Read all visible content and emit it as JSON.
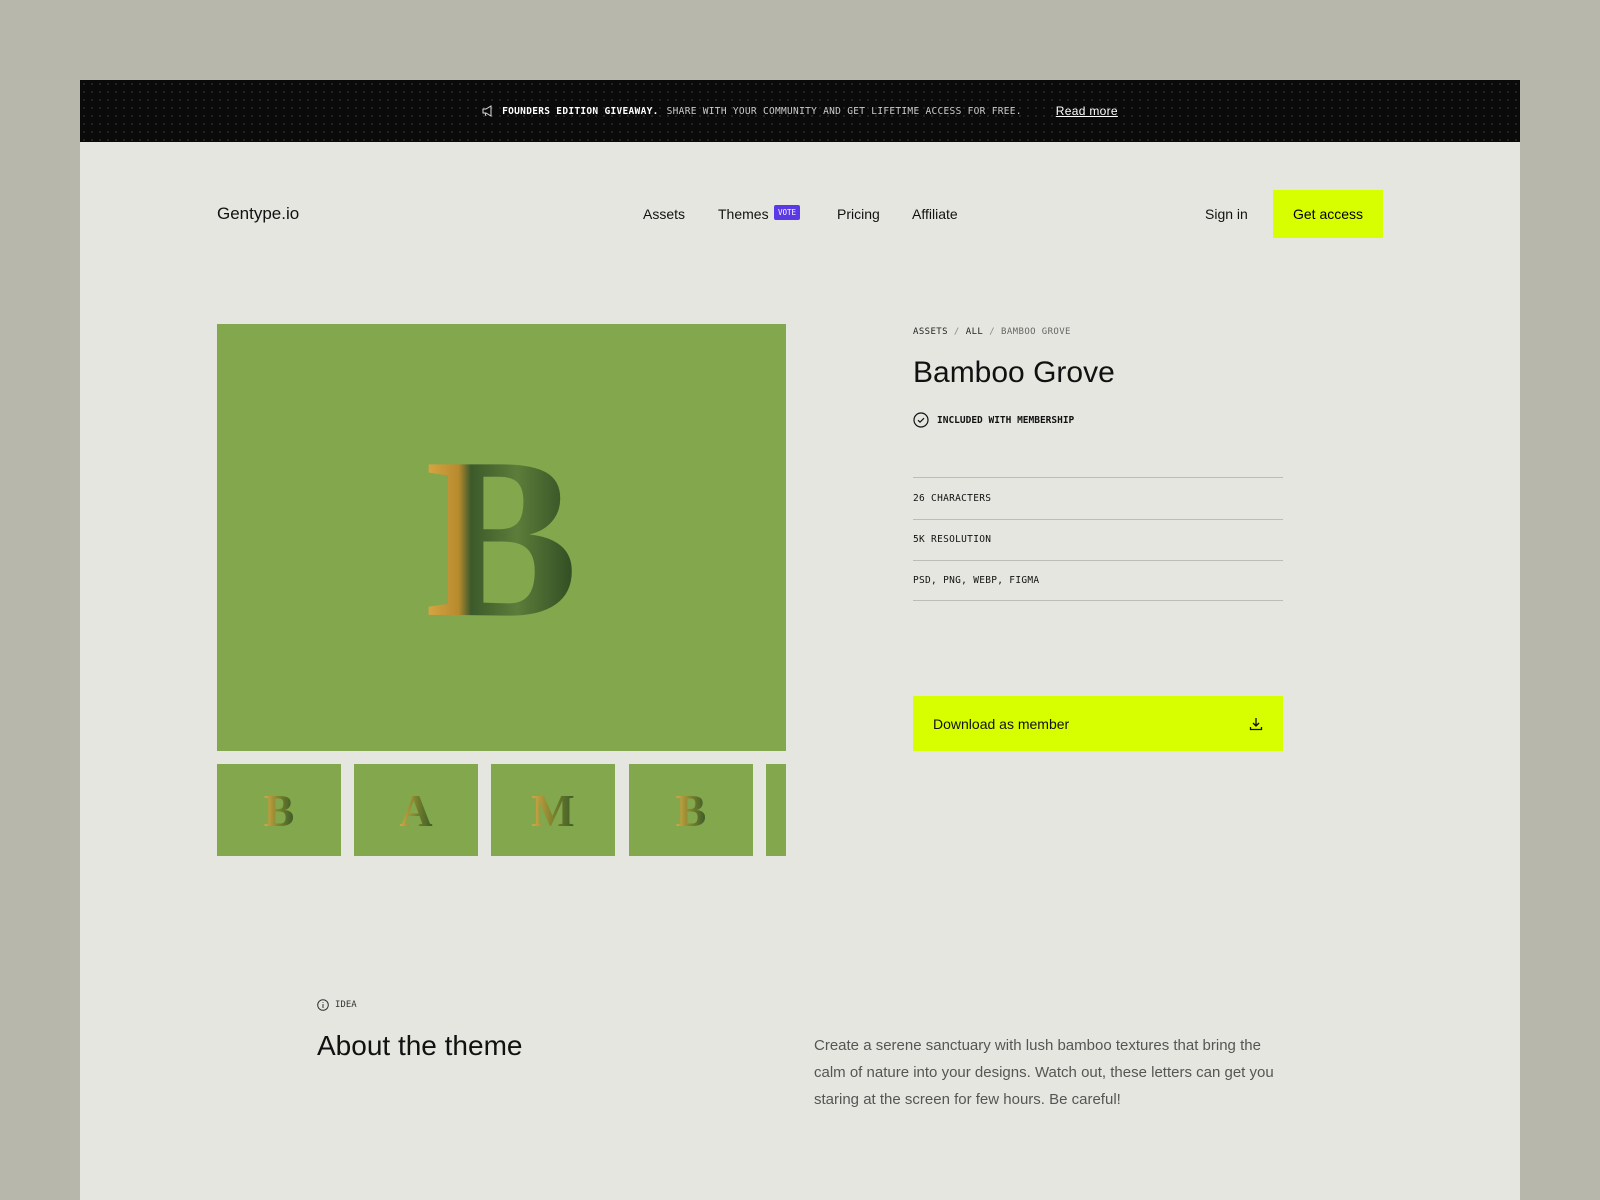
{
  "banner": {
    "icon": "megaphone-icon",
    "headline": "FOUNDERS EDITION GIVEAWAY.",
    "text": "SHARE WITH YOUR COMMUNITY AND GET LIFETIME ACCESS FOR FREE.",
    "link": "Read more"
  },
  "nav": {
    "logo": "Gentype.io",
    "items": [
      {
        "label": "Assets"
      },
      {
        "label": "Themes",
        "badge": "VOTE"
      },
      {
        "label": "Pricing"
      },
      {
        "label": "Affiliate"
      }
    ],
    "sign_in": "Sign in",
    "cta": "Get access"
  },
  "colors": {
    "accent": "#d7ff00",
    "badge": "#5b3ae6",
    "image_bg": "#82a74c"
  },
  "gallery": {
    "main_letter": "B",
    "thumbs": [
      "B",
      "A",
      "M",
      "B",
      ""
    ]
  },
  "product": {
    "breadcrumb": [
      "ASSETS",
      "ALL",
      "BAMBOO GROVE"
    ],
    "title": "Bamboo Grove",
    "included": "INCLUDED WITH MEMBERSHIP",
    "specs": [
      "26 CHARACTERS",
      "5K RESOLUTION",
      "PSD, PNG, WEBP, FIGMA"
    ],
    "download": "Download as member"
  },
  "about": {
    "label": "IDEA",
    "title": "About the theme",
    "text": "Create a serene sanctuary with lush bamboo textures that bring the calm of nature into your designs. Watch out, these letters can get you staring at the screen for few hours. Be careful!"
  }
}
